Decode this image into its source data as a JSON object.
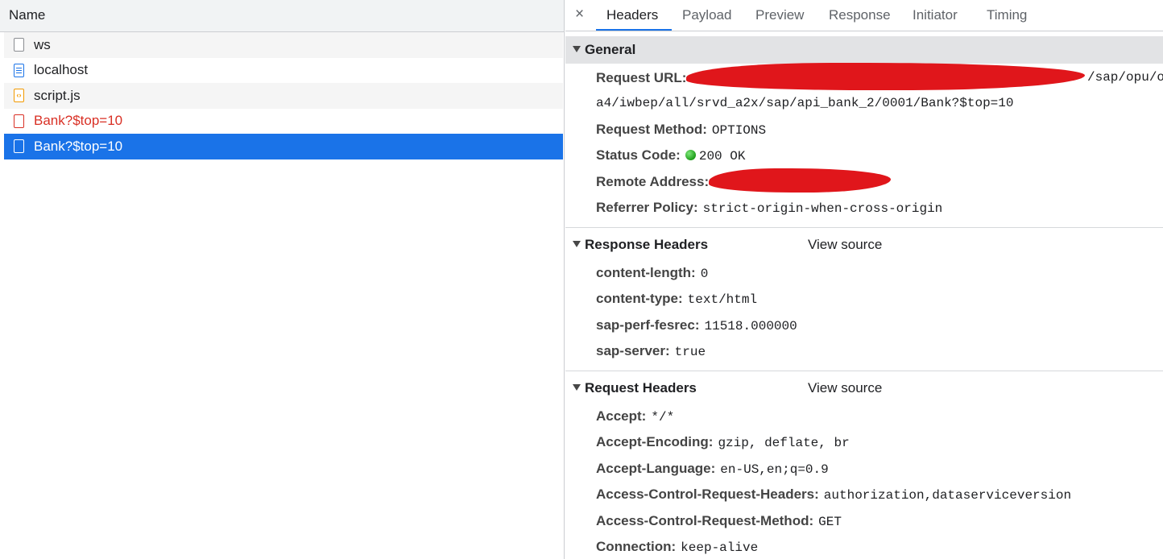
{
  "requests": {
    "column_header": "Name",
    "items": [
      {
        "label": "ws",
        "icon": "blank-file-icon",
        "state": "normal"
      },
      {
        "label": "localhost",
        "icon": "document-icon",
        "state": "normal"
      },
      {
        "label": "script.js",
        "icon": "script-file-icon",
        "state": "normal"
      },
      {
        "label": "Bank?$top=10",
        "icon": "failed-request-icon",
        "state": "error"
      },
      {
        "label": "Bank?$top=10",
        "icon": "blank-file-icon",
        "state": "selected"
      }
    ]
  },
  "tabs": {
    "close_icon": "×",
    "items": [
      "Headers",
      "Payload",
      "Preview",
      "Response",
      "Initiator",
      "Timing"
    ],
    "active": "Headers"
  },
  "general": {
    "title": "General",
    "request_url_label": "Request URL:",
    "request_url_tail": "/sap/opu/o",
    "request_url_line2": "a4/iwbep/all/srvd_a2x/sap/api_bank_2/0001/Bank?$top=10",
    "request_method_label": "Request Method:",
    "request_method": "OPTIONS",
    "status_code_label": "Status Code:",
    "status_code": "200 OK",
    "remote_address_label": "Remote Address:",
    "referrer_policy_label": "Referrer Policy:",
    "referrer_policy": "strict-origin-when-cross-origin"
  },
  "response_headers": {
    "title": "Response Headers",
    "view_source": "View source",
    "items": [
      {
        "k": "content-length:",
        "v": "0"
      },
      {
        "k": "content-type:",
        "v": "text/html"
      },
      {
        "k": "sap-perf-fesrec:",
        "v": "11518.000000"
      },
      {
        "k": "sap-server:",
        "v": "true"
      }
    ]
  },
  "request_headers": {
    "title": "Request Headers",
    "view_source": "View source",
    "items": [
      {
        "k": "Accept:",
        "v": "*/*"
      },
      {
        "k": "Accept-Encoding:",
        "v": "gzip, deflate, br"
      },
      {
        "k": "Accept-Language:",
        "v": "en-US,en;q=0.9"
      },
      {
        "k": "Access-Control-Request-Headers:",
        "v": "authorization,dataserviceversion"
      },
      {
        "k": "Access-Control-Request-Method:",
        "v": "GET"
      },
      {
        "k": "Connection:",
        "v": "keep-alive"
      }
    ]
  },
  "colors": {
    "selected_row": "#1a73e8",
    "error_text": "#d93025",
    "status_ok": "#1e9d1a",
    "redaction": "#e0161b"
  }
}
